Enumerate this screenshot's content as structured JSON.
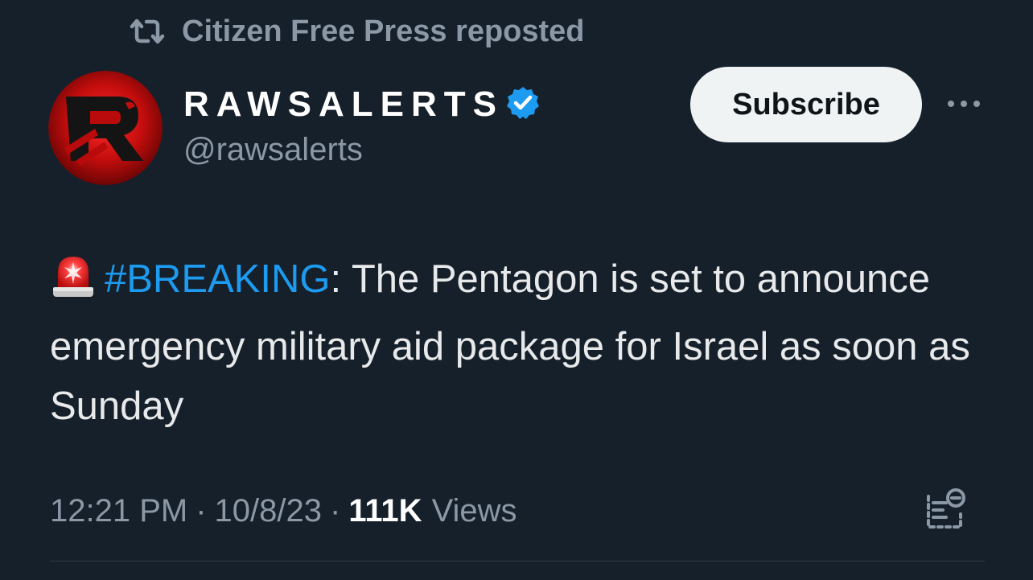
{
  "repost": {
    "icon": "repost-icon",
    "text": "Citizen Free Press reposted"
  },
  "author": {
    "avatar_icon": "rawsalerts-logo",
    "display_name": "RAWSALERTS",
    "verified_icon": "verified-badge-icon",
    "handle": "@rawsalerts"
  },
  "actions": {
    "subscribe_label": "Subscribe",
    "more_icon": "more-horizontal-icon"
  },
  "tweet": {
    "emoji_icon": "police-siren-icon",
    "hashtag": "#BREAKING",
    "body_after_hashtag": ": The Pentagon is set to announce emergency military aid package for Israel as soon as Sunday"
  },
  "meta": {
    "time": "12:21 PM",
    "separator": "·",
    "date": "10/8/23",
    "views_count": "111K",
    "views_label": "Views",
    "analytics_icon": "post-analytics-icon"
  },
  "colors": {
    "background": "#16202b",
    "accent": "#1d9bf0",
    "secondary_text": "#8b98a5",
    "primary_text": "#e7e9ea"
  }
}
